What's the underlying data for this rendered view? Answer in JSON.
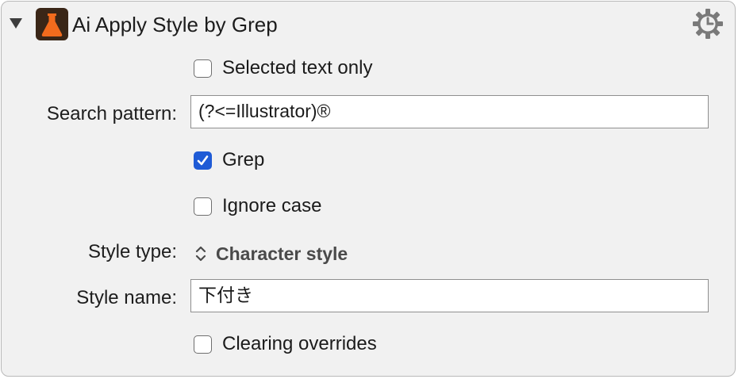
{
  "action": {
    "title": "Ai Apply Style by Grep",
    "icon": "flask-icon",
    "settings_icon": "gear-icon"
  },
  "options": {
    "selected_text_only": {
      "label": "Selected text only",
      "checked": false
    },
    "search_pattern": {
      "label": "Search pattern:",
      "value": "(?<=Illustrator)®"
    },
    "grep": {
      "label": "Grep",
      "checked": true
    },
    "ignore_case": {
      "label": "Ignore case",
      "checked": false
    },
    "style_type": {
      "label": "Style type:",
      "value": "Character style"
    },
    "style_name": {
      "label": "Style name:",
      "value": "下付き"
    },
    "clearing_overrides": {
      "label": "Clearing overrides",
      "checked": false
    }
  },
  "colors": {
    "checkbox_checked": "#1f5bd6",
    "icon_background": "#3a2617",
    "icon_flask": "#f26b1d"
  }
}
